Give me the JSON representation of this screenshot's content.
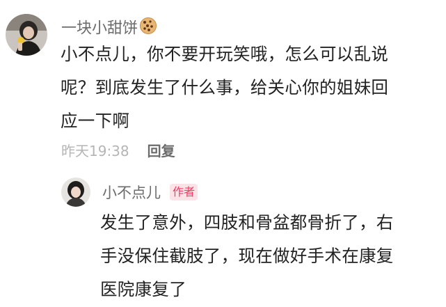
{
  "comment": {
    "username": "一块小甜饼",
    "username_icon": "cookie-icon",
    "text_lines": [
      "小不点儿，你不要开玩笑哦，怎么可以乱说",
      "呢？到底发生了什么事，给关心你的姐妹回",
      "应一下啊"
    ],
    "timestamp": "昨天19:38",
    "reply_label": "回复"
  },
  "reply": {
    "username": "小不点儿",
    "badge": "作者",
    "text_lines": [
      "发生了意外，四肢和骨盆都骨折了，右",
      "手没保住截肢了，现在做好手术在康复",
      "医院康复了"
    ]
  },
  "colors": {
    "username": "#6b6b6b",
    "body_text": "#222222",
    "timestamp": "#b5b5b5",
    "badge_text": "#ee3c62",
    "badge_bg": "#fbe3e8"
  }
}
